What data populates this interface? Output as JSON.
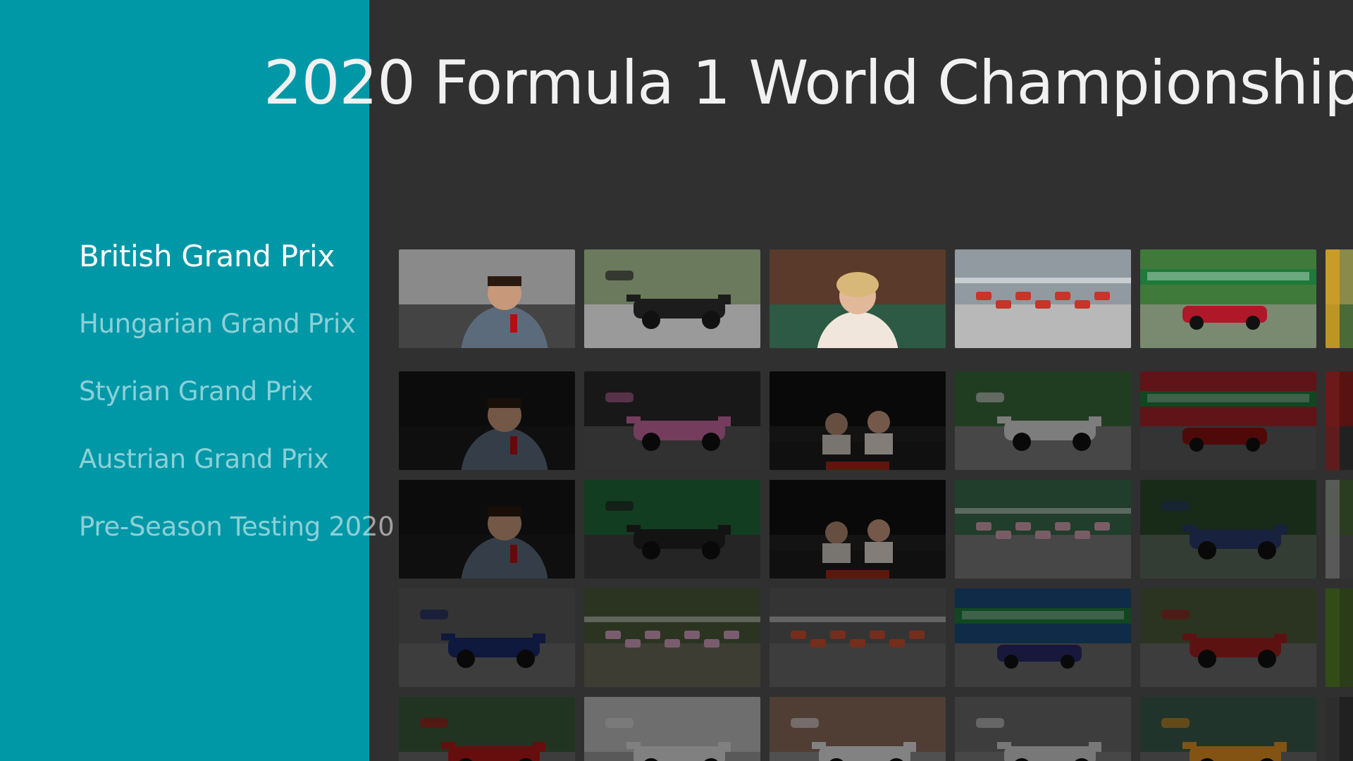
{
  "title": "2020 Formula 1 World Championship",
  "categories": [
    {
      "label": "British Grand Prix",
      "active": true
    },
    {
      "label": "Hungarian Grand Prix",
      "active": false
    },
    {
      "label": "Styrian Grand Prix",
      "active": false
    },
    {
      "label": "Austrian Grand Prix",
      "active": false
    },
    {
      "label": "Pre-Season Testing 2020",
      "active": false
    }
  ],
  "colors": {
    "sidebar": "#0097a7",
    "background": "#303030",
    "title": "#f1f1f1"
  },
  "rows": [
    [
      {
        "scene": "presenter-mic",
        "sky": "#8a8a8a",
        "ground": "#444444",
        "car": "#4b6aa0"
      },
      {
        "scene": "cars-track",
        "sky": "#6b7a5c",
        "ground": "#9a9a9a",
        "car": "#1c1c1c"
      },
      {
        "scene": "studio-host",
        "sky": "#5a3a2a",
        "ground": "#2c5a44",
        "car": "#f0e6dc"
      },
      {
        "scene": "grid-start",
        "sky": "#909aa0",
        "ground": "#b8b8b8",
        "car": "#c8342a"
      },
      {
        "scene": "race-banner",
        "sky": "#3f7a3a",
        "ground": "#7a8a70",
        "car": "#b0182a"
      },
      {
        "scene": "edge",
        "sky": "#8a8a4a",
        "ground": "#4a6a3a",
        "car": "#d8a020"
      }
    ],
    [
      {
        "scene": "presenter-dark",
        "sky": "#151515",
        "ground": "#1b1b1b",
        "car": "#556677"
      },
      {
        "scene": "cars-track",
        "sky": "#2a2a2a",
        "ground": "#555555",
        "car": "#c86aa0"
      },
      {
        "scene": "studio-duo",
        "sky": "#101010",
        "ground": "#222222",
        "car": "#c84030"
      },
      {
        "scene": "cars-track",
        "sky": "#3a6a3a",
        "ground": "#7a7a7a",
        "car": "#d8d8d8"
      },
      {
        "scene": "race-banner",
        "sky": "#a8242a",
        "ground": "#5a5a5a",
        "car": "#8a1010"
      },
      {
        "scene": "edge",
        "sky": "#9a2020",
        "ground": "#3a3a3a",
        "car": "#c03030"
      }
    ],
    [
      {
        "scene": "presenter-dark",
        "sky": "#151515",
        "ground": "#1b1b1b",
        "car": "#556677"
      },
      {
        "scene": "cars-track",
        "sky": "#1f6a3a",
        "ground": "#404040",
        "car": "#222222"
      },
      {
        "scene": "studio-duo",
        "sky": "#101010",
        "ground": "#222222",
        "car": "#c84030"
      },
      {
        "scene": "grid-start",
        "sky": "#3a6a4a",
        "ground": "#7a7a7a",
        "car": "#d0a0b0"
      },
      {
        "scene": "cars-track",
        "sky": "#2a4a2a",
        "ground": "#5a6a5a",
        "car": "#2a3a6a"
      },
      {
        "scene": "edge",
        "sky": "#4a6a3a",
        "ground": "#5a5a5a",
        "car": "#aaaaaa"
      }
    ],
    [
      {
        "scene": "cars-track",
        "sky": "#5a5a5a",
        "ground": "#6a6a6a",
        "car": "#1a2a6a"
      },
      {
        "scene": "grid-start",
        "sky": "#4a5a3a",
        "ground": "#6a6a5a",
        "car": "#d0a0c0"
      },
      {
        "scene": "grid-start",
        "sky": "#5a5a5a",
        "ground": "#6a6a6a",
        "car": "#c85030"
      },
      {
        "scene": "race-banner",
        "sky": "#1a4a7a",
        "ground": "#6a6a6a",
        "car": "#2a2a6a"
      },
      {
        "scene": "cars-track",
        "sky": "#4a5a3a",
        "ground": "#6a6a6a",
        "car": "#a02020"
      },
      {
        "scene": "edge",
        "sky": "#4a6a2a",
        "ground": "#4a6a2a",
        "car": "#5a8a2a"
      }
    ],
    [
      {
        "scene": "cars-track",
        "sky": "#3a5a3a",
        "ground": "#6a6a6a",
        "car": "#b01818"
      },
      {
        "scene": "cars-track",
        "sky": "#bdbdbd",
        "ground": "#9a9a9a",
        "car": "#dddddd"
      },
      {
        "scene": "cars-track",
        "sky": "#8a6a5a",
        "ground": "#8a8a8a",
        "car": "#e0e0e0"
      },
      {
        "scene": "cars-track",
        "sky": "#6a6a6a",
        "ground": "#7a7a7a",
        "car": "#cfcfcf"
      },
      {
        "scene": "cars-track",
        "sky": "#3a5a4a",
        "ground": "#6a6a6a",
        "car": "#e09020"
      },
      {
        "scene": "edge",
        "sky": "#3a3a3a",
        "ground": "#3a3a3a",
        "car": "#555555"
      }
    ]
  ]
}
